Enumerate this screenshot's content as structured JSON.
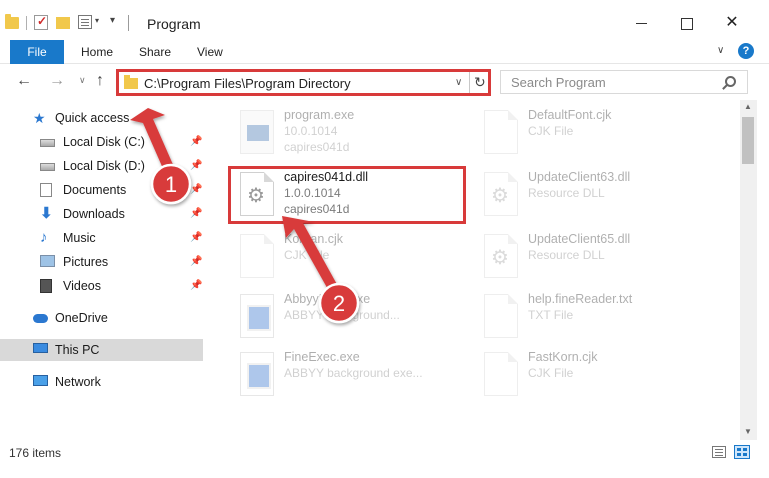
{
  "window": {
    "title": "Program",
    "close_glyph": "✕"
  },
  "ribbon": {
    "file_label": "File",
    "home_label": "Home",
    "share_label": "Share",
    "view_label": "View",
    "expand_glyph": "∨",
    "help_glyph": "?"
  },
  "navigation": {
    "back_glyph": "←",
    "forward_glyph": "→",
    "recent_glyph": "∨",
    "up_glyph": "↑",
    "address_path": "C:\\Program Files\\Program Directory",
    "address_dropdown_glyph": "∨",
    "refresh_glyph": "↻",
    "search_placeholder": "Search Program"
  },
  "sidebar": {
    "pin_glyph": "📌",
    "items": [
      {
        "label": "Quick access",
        "icon": "star-icon",
        "glyph": "★"
      },
      {
        "label": "Local Disk (C:)",
        "icon": "disk-icon"
      },
      {
        "label": "Local Disk (D:)",
        "icon": "disk-icon"
      },
      {
        "label": "Documents",
        "icon": "documents-icon"
      },
      {
        "label": "Downloads",
        "icon": "download-icon",
        "glyph": "⬇"
      },
      {
        "label": "Music",
        "icon": "music-icon",
        "glyph": "♪"
      },
      {
        "label": "Pictures",
        "icon": "pictures-icon"
      },
      {
        "label": "Videos",
        "icon": "videos-icon"
      },
      {
        "label": "OneDrive",
        "icon": "cloud-icon"
      },
      {
        "label": "This PC",
        "icon": "computer-icon",
        "selected": true
      },
      {
        "label": "Network",
        "icon": "network-icon"
      }
    ]
  },
  "files": [
    {
      "name": "program.exe",
      "line2": "10.0.1014",
      "line3": "capires041d",
      "icon": "exe-icon"
    },
    {
      "name": "DefaultFont.cjk",
      "line2": "CJK File",
      "icon": "file-icon"
    },
    {
      "name": "capires041d.dll",
      "line2": "1.0.0.1014",
      "line3": "capires041d",
      "icon": "gear-file-icon"
    },
    {
      "name": "UpdateClient63.dll",
      "line2": "Resource DLL",
      "icon": "gear-file-icon"
    },
    {
      "name": "Korean.cjk",
      "line2": "CJK File",
      "icon": "file-icon"
    },
    {
      "name": "UpdateClient65.dll",
      "line2": "Resource DLL",
      "icon": "gear-file-icon"
    },
    {
      "name": "AbbyyExec.exe",
      "line2": "ABBYY background...",
      "icon": "app-icon"
    },
    {
      "name": "help.fineReader.txt",
      "line2": "TXT File",
      "icon": "file-icon"
    },
    {
      "name": "FineExec.exe",
      "line2": "ABBYY background exe...",
      "icon": "app-icon"
    },
    {
      "name": "FastKorn.cjk",
      "line2": "CJK File",
      "icon": "file-icon"
    }
  ],
  "scrollbar": {
    "up_glyph": "▲",
    "down_glyph": "▼"
  },
  "status": {
    "item_count": "176 items"
  },
  "annotations": {
    "step1": "1",
    "step2": "2",
    "color": "#d83a3a"
  }
}
